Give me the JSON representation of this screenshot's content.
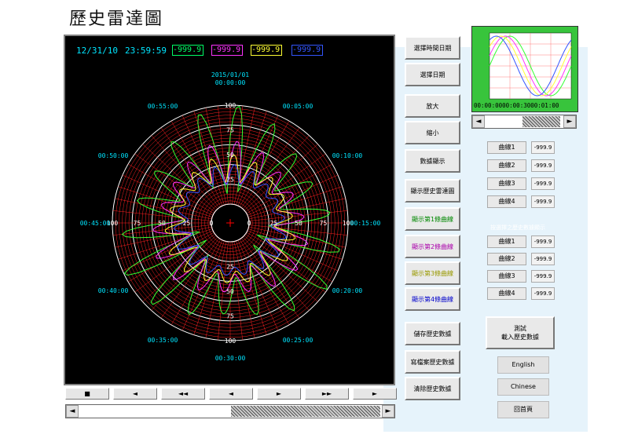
{
  "title": "歷史雷達圖",
  "header": {
    "date": "12/31/10",
    "time": "23:59:59",
    "values": [
      {
        "text": "-999.9",
        "color": "#00ff66"
      },
      {
        "text": "-999.9",
        "color": "#ff33ff"
      },
      {
        "text": "-999.9",
        "color": "#ffff33"
      },
      {
        "text": "-999.9",
        "color": "#3355ff"
      }
    ]
  },
  "radar": {
    "center_date": "2015/01/01",
    "center_time": "00:00:00",
    "time_labels": [
      "00:05:00",
      "00:10:00",
      "00:15:00",
      "00:20:00",
      "00:25:00",
      "00:30:00",
      "00:35:00",
      "00:40:00",
      "00:45:00",
      "00:50:00",
      "00:55:00"
    ],
    "radial_ticks": [
      "0",
      "25",
      "50",
      "75",
      "100"
    ],
    "colors": {
      "series1": "#33ff33",
      "series2": "#ff33ff",
      "series3": "#ffff33",
      "series4": "#3355ff",
      "grid": "#ff2020",
      "ring": "#ffffff"
    }
  },
  "transport": {
    "buttons": [
      "■",
      "◄",
      "◄◄",
      "◄",
      "►",
      "►►",
      "►"
    ]
  },
  "right_buttons": [
    {
      "label": "選擇時間日期"
    },
    {
      "label": "選擇日期"
    },
    {
      "label": "放大"
    },
    {
      "label": "縮小"
    },
    {
      "label": "數據顯示"
    },
    {
      "label": "顯示歷史雷達圖"
    },
    {
      "label": "顯示第1條曲線",
      "color": "#008800"
    },
    {
      "label": "顯示第2條曲線",
      "color": "#aa00aa"
    },
    {
      "label": "顯示第3條曲線",
      "color": "#999900"
    },
    {
      "label": "顯示第4條曲線",
      "color": "#0000cc"
    },
    {
      "label": "儲存歷史數據"
    },
    {
      "label": "寫檔案歷史數據"
    },
    {
      "label": "清除歷史數據"
    }
  ],
  "mini": {
    "label": "00:00:0000:00:3000:01:00"
  },
  "group1": {
    "title": "",
    "rows": [
      {
        "label": "曲線1",
        "value": "-999.9"
      },
      {
        "label": "曲線2",
        "value": "-999.9"
      },
      {
        "label": "曲線3",
        "value": "-999.9"
      },
      {
        "label": "曲線4",
        "value": "-999.9"
      }
    ]
  },
  "group2": {
    "title": "按選擇之歷史數據顯示",
    "rows": [
      {
        "label": "曲線1",
        "value": "-999.9"
      },
      {
        "label": "曲線2",
        "value": "-999.9"
      },
      {
        "label": "曲線3",
        "value": "-999.9"
      },
      {
        "label": "曲線4",
        "value": "-999.9"
      }
    ]
  },
  "big_button": {
    "line1": "測試",
    "line2": "載入歷史數據"
  },
  "lang_buttons": [
    "English",
    "Chinese",
    "回首頁"
  ]
}
